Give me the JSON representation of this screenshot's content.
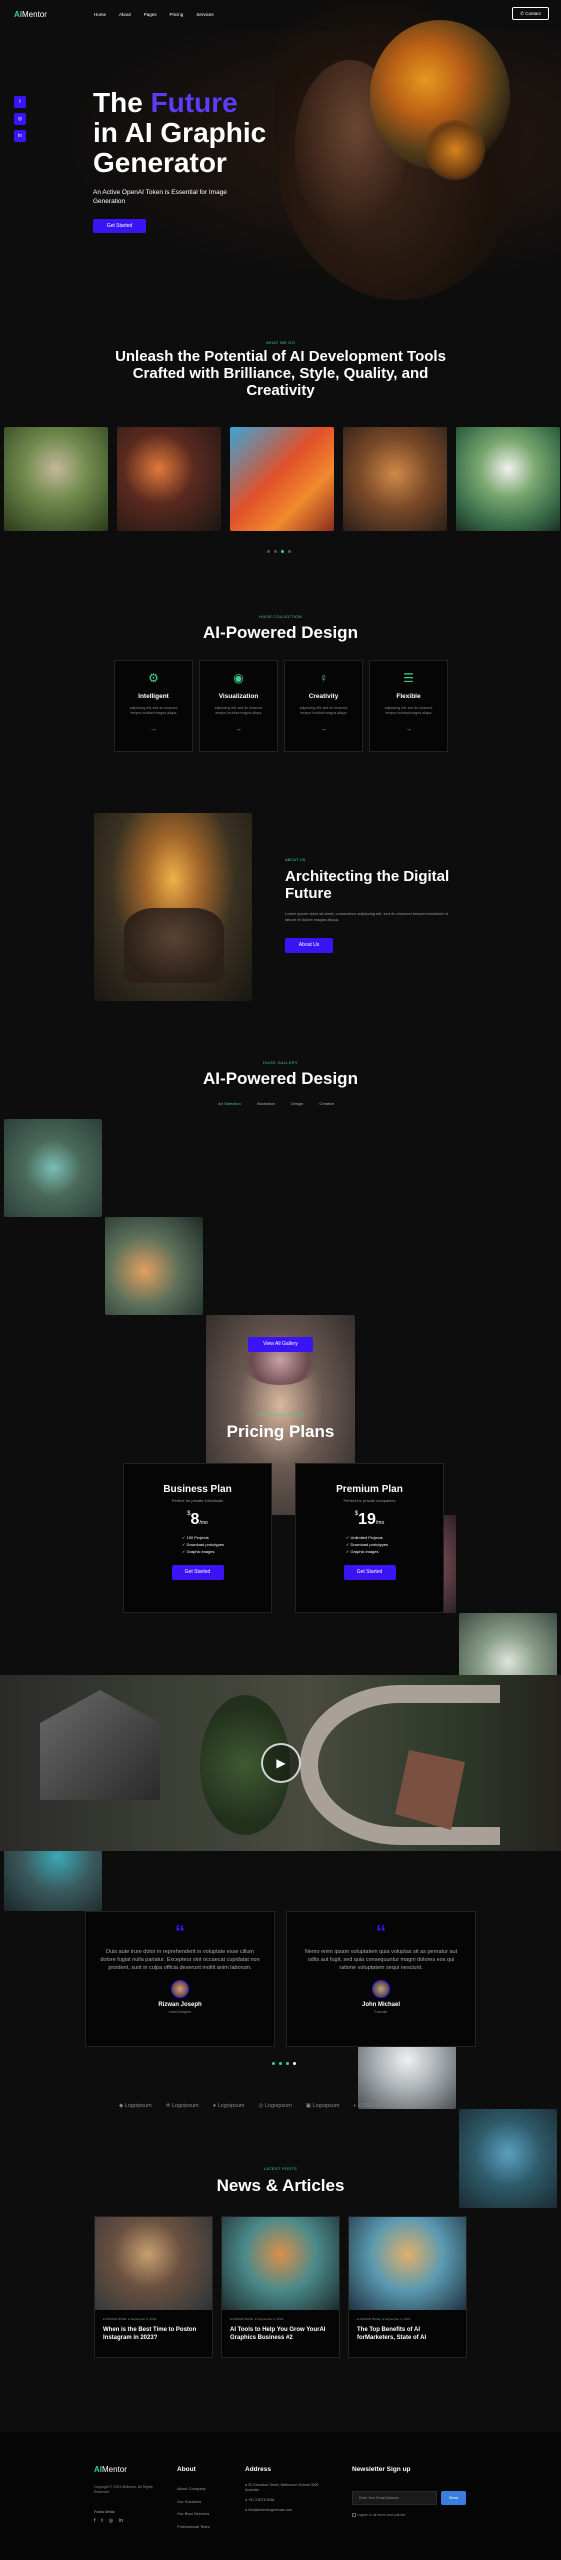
{
  "header": {
    "logo_ai": "AI",
    "logo_rest": "Mentor",
    "nav": [
      "Home",
      "About",
      "Pages",
      "Pricing",
      "Services"
    ],
    "contact": "Contact"
  },
  "hero": {
    "title_1": "The ",
    "title_highlight": "Future",
    "title_2": "in AI Graphic",
    "title_3": "Generator",
    "subtitle": "An Active OpenAI Token is Essential for Image Generation",
    "cta": "Get Started"
  },
  "intro": {
    "kicker": "WHAT WE DO",
    "title": "Unleash the Potential of AI Development Tools Crafted with Brilliance, Style, Quality, and Creativity"
  },
  "features": {
    "kicker": "HUGE COLLECTION",
    "title": "AI-Powered Design",
    "items": [
      {
        "title": "Intelligent",
        "text": "adipiscing elit, sed do eiusmod tempor incidunt magna aliqua"
      },
      {
        "title": "Visualization",
        "text": "adipiscing elit, sed do eiusmod tempor incidunt magna aliqua"
      },
      {
        "title": "Creativity",
        "text": "adipiscing elit, sed do eiusmod tempor incidunt magna aliqua"
      },
      {
        "title": "Flexible",
        "text": "adipiscing elit, sed do eiusmod tempor incidunt magna aliqua"
      }
    ]
  },
  "about": {
    "kicker": "ABOUT US",
    "title": "Architecting the Digital Future",
    "text": "Lorem ipsum dolor sit amet, consectetur adipiscing elit, sed do eiusmod tempor incididunt ut labore et dolore magna aliqua.",
    "cta": "About Us"
  },
  "gallery": {
    "kicker": "HUGE GALLERY",
    "title": "AI-Powered Design",
    "tabs": [
      "Art Selection",
      "Illustration",
      "Design",
      "Creative"
    ],
    "cta": "View All Gallery"
  },
  "pricing": {
    "kicker": "AFFORDABLE PLANS",
    "title": "Pricing Plans",
    "plans": [
      {
        "name": "Business Plan",
        "desc": "Perfect for private individuals",
        "currency": "$",
        "price": "8",
        "period": "/mo",
        "features": [
          "150 Projects",
          "Download prototypes",
          "Graphic images"
        ],
        "cta": "Get Started"
      },
      {
        "name": "Premium Plan",
        "desc": "Perfect for private companies",
        "currency": "$",
        "price": "19",
        "period": "/mo",
        "features": [
          "Unlimited Projects",
          "Download prototypes",
          "Graphic images"
        ],
        "cta": "Get Started"
      }
    ]
  },
  "testimonials": [
    {
      "quote": "Duis aute irure dolor in reprehenderit in voluptate esse cillum dolore fugiat nulla pariatur. Excepteur sint occaecat cupidatat non proident, sunt in culpa officia deserunt mollit anim laborum.",
      "name": "Rizwan Joseph",
      "role": "Lead Designer"
    },
    {
      "quote": "Nemo enim ipsam voluptatem quia voluptas sit as pernatur aut odits aut fugit, sed quia consequuntur magni dolores eos qui ratione voluptatem sequi nesciunt.",
      "name": "John Michael",
      "role": "Founder"
    }
  ],
  "logos": [
    "Logoipsum",
    "Logoipsum",
    "Logoipsum",
    "Logoipsum",
    "Logoipsum",
    "LOGO IPSUM"
  ],
  "news": {
    "kicker": "LATEST POSTS",
    "title": "News & Articles",
    "posts": [
      {
        "author": "RISHAD ROSE",
        "date": "September 4, 2023",
        "title": "When is the Best Time to Poston Instagram in 2023?"
      },
      {
        "author": "RISHAD ROSE",
        "date": "September 4, 2023",
        "title": "AI Tools to Help You Grow YourAI Graphics Business #2"
      },
      {
        "author": "RISHAD ROSE",
        "date": "September 4, 2023",
        "title": "The Top Benefits of AI forMarketers, State of AI"
      }
    ]
  },
  "footer": {
    "logo_ai": "AI",
    "logo_rest": "Mentor",
    "copyright": "Copyright © 2023 AIMentor. All Rights Reserved",
    "follow": "Follow Media",
    "about_title": "About",
    "about_links": [
      "About Company",
      "Our Solutions",
      "Our Best Services",
      "Professional Team"
    ],
    "address_title": "Address",
    "address": "32 Grandson Street, Melbourne Victoria 3000 Australia",
    "phone": "+61 3 8376 6284",
    "email": "info@aimentorgenerate.com",
    "newsletter_title": "Newsletter Sign up",
    "email_placeholder": "Enter Your Email Address",
    "subscribe": "Send",
    "agree": "I agree to all terms and policies"
  }
}
